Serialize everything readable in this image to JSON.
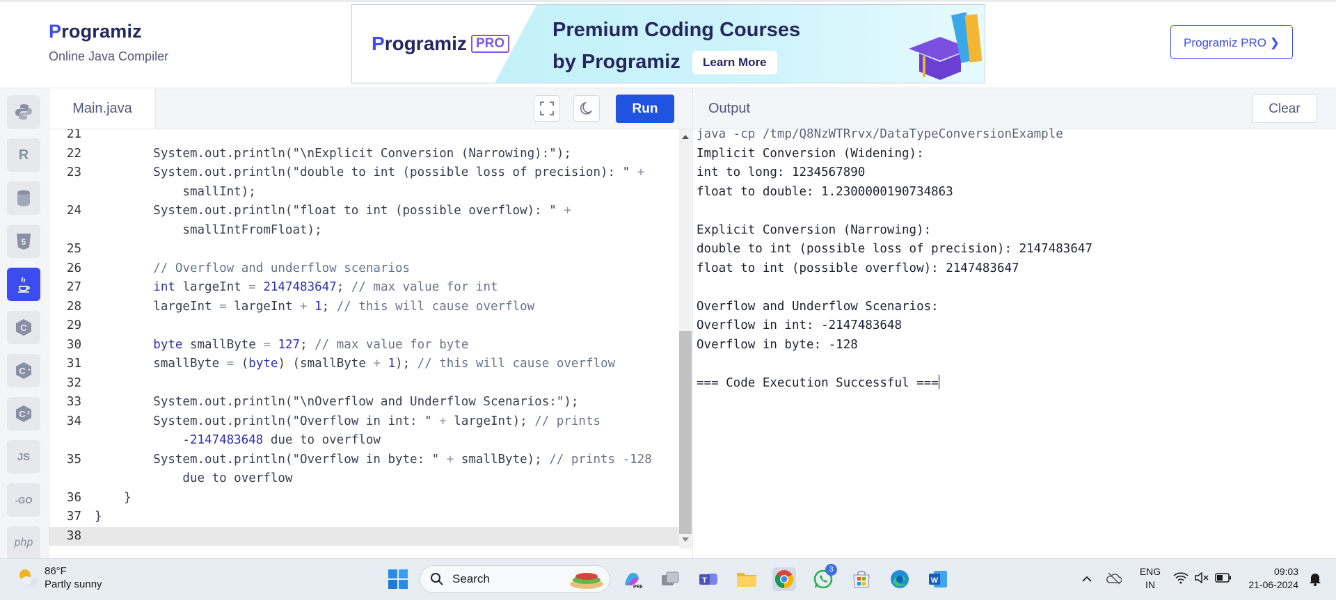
{
  "header": {
    "brand_name": "rogramiz",
    "brand_p": "P",
    "brand_subtitle": "Online Java Compiler",
    "ad": {
      "logo_text": "rogramiz",
      "logo_p": "P",
      "badge": "PRO",
      "title_line1": "Premium Coding Courses",
      "title_line2": "by Programiz",
      "cta": "Learn More"
    },
    "pro_button": "Programiz PRO ❯"
  },
  "sidebar": {
    "items": [
      {
        "name": "python",
        "label": "",
        "active": false
      },
      {
        "name": "r",
        "label": "R",
        "active": false
      },
      {
        "name": "sql",
        "label": "",
        "active": false
      },
      {
        "name": "html",
        "label": "5",
        "active": false
      },
      {
        "name": "java",
        "label": "",
        "active": true
      },
      {
        "name": "c",
        "label": "C",
        "active": false
      },
      {
        "name": "cpp",
        "label": "C",
        "active": false
      },
      {
        "name": "csharp",
        "label": "C",
        "active": false
      },
      {
        "name": "js",
        "label": "JS",
        "active": false
      },
      {
        "name": "go",
        "label": "-GO",
        "active": false
      },
      {
        "name": "php",
        "label": "php",
        "active": false
      }
    ]
  },
  "editor": {
    "tab": "Main.java",
    "run_label": "Run",
    "lines": [
      {
        "n": "21",
        "code": ""
      },
      {
        "n": "22",
        "code": "        System.out.println(\"\\nExplicit Conversion (Narrowing):\");"
      },
      {
        "n": "23",
        "code": "        System.out.println(\"double to int (possible loss of precision): \" +"
      },
      {
        "n": "",
        "code": "            smallInt);"
      },
      {
        "n": "24",
        "code": "        System.out.println(\"float to int (possible overflow): \" +"
      },
      {
        "n": "",
        "code": "            smallIntFromFloat);"
      },
      {
        "n": "25",
        "code": ""
      },
      {
        "n": "26",
        "code": "        // Overflow and underflow scenarios"
      },
      {
        "n": "27",
        "code": "        int largeInt = 2147483647; // max value for int"
      },
      {
        "n": "28",
        "code": "        largeInt = largeInt + 1; // this will cause overflow"
      },
      {
        "n": "29",
        "code": ""
      },
      {
        "n": "30",
        "code": "        byte smallByte = 127; // max value for byte"
      },
      {
        "n": "31",
        "code": "        smallByte = (byte) (smallByte + 1); // this will cause overflow"
      },
      {
        "n": "32",
        "code": ""
      },
      {
        "n": "33",
        "code": "        System.out.println(\"\\nOverflow and Underflow Scenarios:\");"
      },
      {
        "n": "34",
        "code": "        System.out.println(\"Overflow in int: \" + largeInt); // prints"
      },
      {
        "n": "",
        "code": "            -2147483648 due to overflow"
      },
      {
        "n": "35",
        "code": "        System.out.println(\"Overflow in byte: \" + smallByte); // prints -128"
      },
      {
        "n": "",
        "code": "            due to overflow"
      },
      {
        "n": "36",
        "code": "    }"
      },
      {
        "n": "37",
        "code": "}"
      },
      {
        "n": "38",
        "code": ""
      }
    ]
  },
  "output": {
    "title": "Output",
    "clear_label": "Clear",
    "lines": [
      "java -cp /tmp/Q8NzWTRrvx/DataTypeConversionExample",
      "Implicit Conversion (Widening):",
      "int to long: 1234567890",
      "float to double: 1.2300000190734863",
      "",
      "Explicit Conversion (Narrowing):",
      "double to int (possible loss of precision): 2147483647",
      "float to int (possible overflow): 2147483647",
      "",
      "Overflow and Underflow Scenarios:",
      "Overflow in int: -2147483648",
      "Overflow in byte: -128",
      "",
      "=== Code Execution Successful ==="
    ]
  },
  "taskbar": {
    "weather_temp": "86°F",
    "weather_desc": "Partly sunny",
    "search_label": "Search",
    "whatsapp_badge": "3",
    "lang_top": "ENG",
    "lang_bottom": "IN",
    "time": "09:03",
    "date": "21-06-2024"
  },
  "colors": {
    "accent": "#3b4cf0",
    "run": "#1f53e0",
    "brand_text": "#25265e"
  }
}
